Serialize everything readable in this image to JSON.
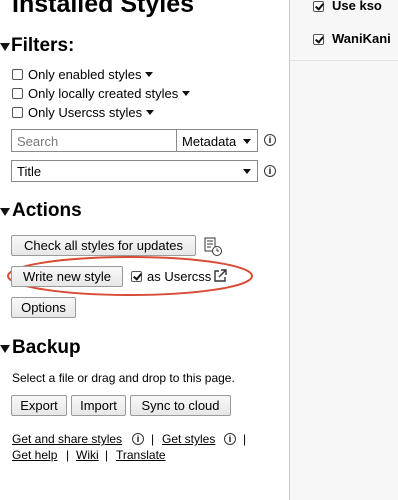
{
  "page": {
    "title": "Installed Styles"
  },
  "filters": {
    "heading": "Filters:",
    "options": [
      {
        "label": "Only enabled styles",
        "checked": false
      },
      {
        "label": "Only locally created styles",
        "checked": false
      },
      {
        "label": "Only Usercss styles",
        "checked": false
      }
    ],
    "search_placeholder": "Search",
    "search_mode": "Metadata",
    "sort_by": "Title"
  },
  "actions": {
    "heading": "Actions",
    "check_updates_label": "Check all styles for updates",
    "write_new_style_label": "Write new style",
    "as_usercss_label": "as Usercss",
    "as_usercss_checked": true,
    "options_label": "Options"
  },
  "backup": {
    "heading": "Backup",
    "description": "Select a file or drag and drop to this page.",
    "export_label": "Export",
    "import_label": "Import",
    "sync_label": "Sync to cloud"
  },
  "links": {
    "get_share": "Get and share styles",
    "get_styles": "Get styles",
    "get_help": "Get help",
    "wiki": "Wiki",
    "translate": "Translate"
  },
  "style_list": [
    {
      "name": "Use kso",
      "enabled": true
    },
    {
      "name": "WaniKani",
      "enabled": true
    }
  ],
  "colors": {
    "highlight_ellipse": "#d84b35",
    "right_panel_bg": "#f7f7f7",
    "divider": "#c9c9c9"
  }
}
